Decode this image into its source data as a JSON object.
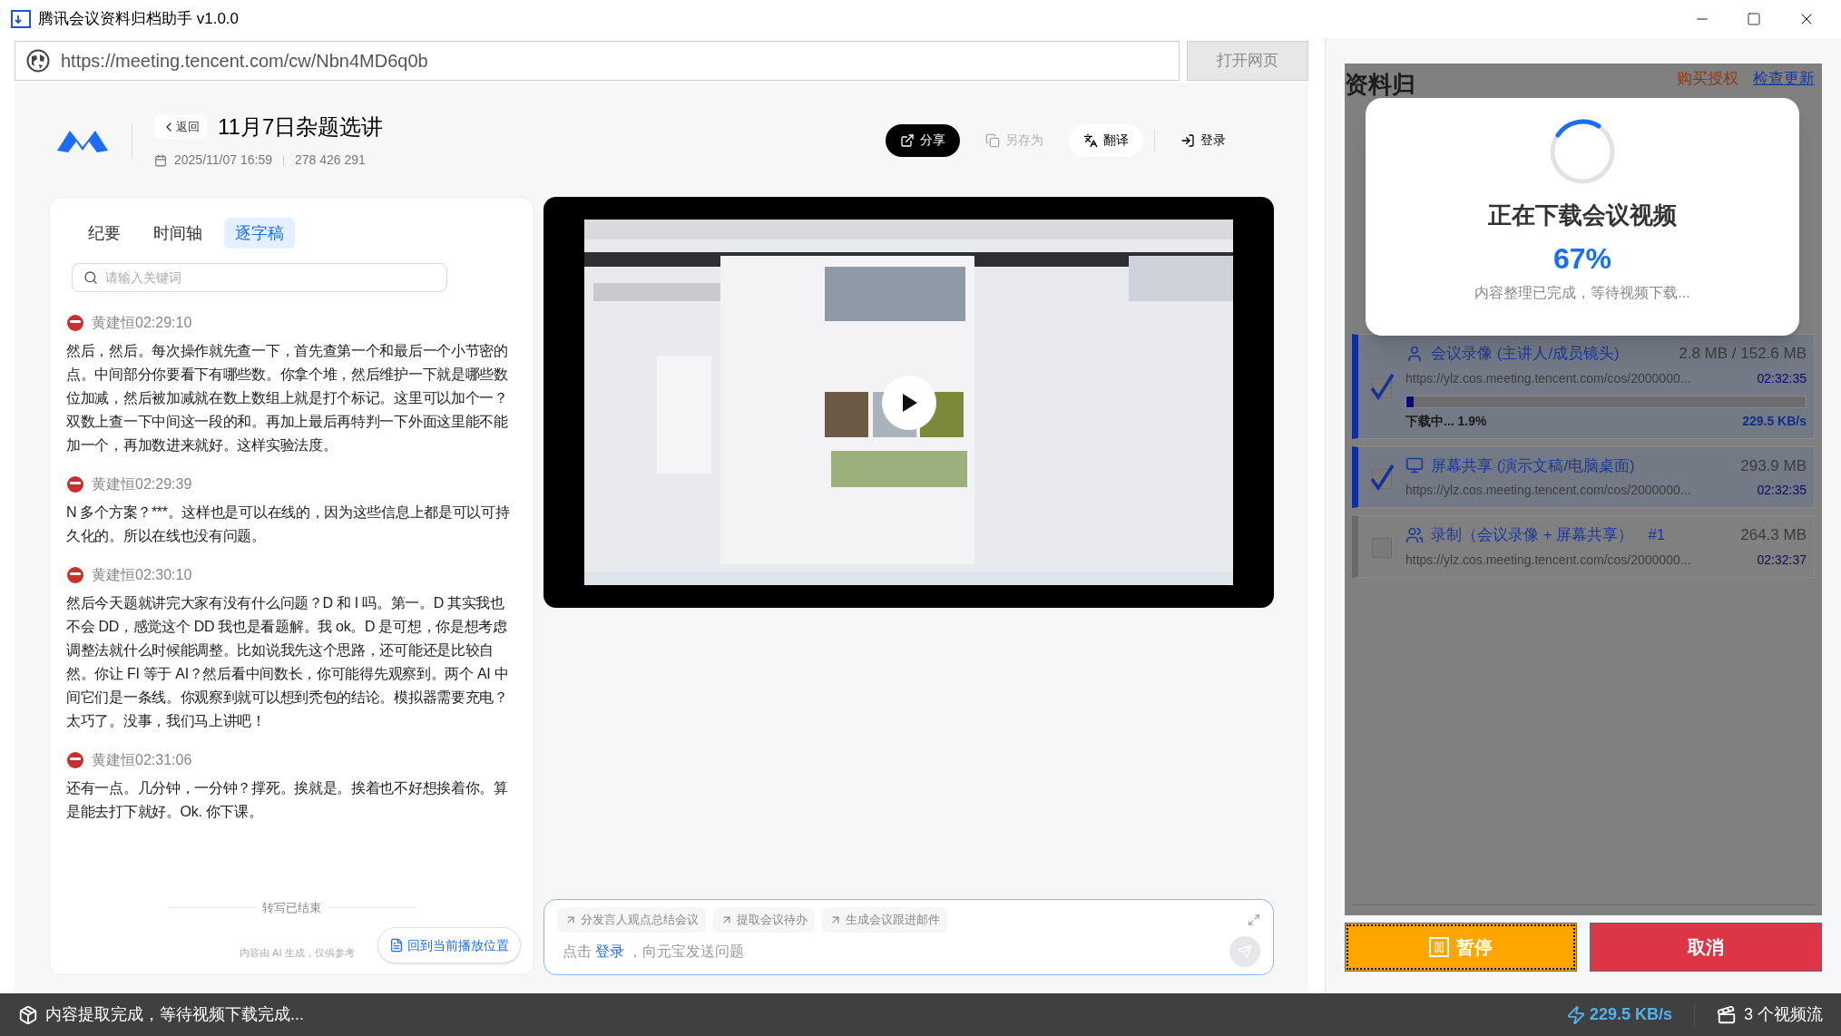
{
  "window": {
    "title": "腾讯会议资料归档助手 v1.0.0"
  },
  "address_bar": {
    "url": "https://meeting.tencent.com/cw/Nbn4MD6q0b",
    "button": "打开网页",
    "button_disabled": true
  },
  "meeting": {
    "back": "返回",
    "title": "11月7日杂题选讲",
    "date": "2025/11/07 16:59",
    "meeting_id": "278 426 291",
    "actions": [
      {
        "label": "分享",
        "kind": "share",
        "disabled": false
      },
      {
        "label": "另存为",
        "kind": "save",
        "disabled": true
      },
      {
        "label": "翻译",
        "kind": "translate",
        "disabled": false
      },
      {
        "label": "登录",
        "kind": "login",
        "disabled": false
      }
    ]
  },
  "transcript": {
    "tabs": [
      {
        "label": "纪要",
        "selected": false
      },
      {
        "label": "时间轴",
        "selected": false
      },
      {
        "label": "逐字稿",
        "selected": true
      }
    ],
    "search": {
      "placeholder": "请输入关键词"
    },
    "entries": [
      {
        "speaker": "黄建恒",
        "time": "02:29:10",
        "text": "然后，然后。每次操作就先查一下，首先查第一个和最后一个小节密的点。中间部分你要看下有哪些数。你拿个堆，然后维护一下就是哪些数位加减，然后被加减就在数上数组上就是打个标记。这里可以加个一？双数上查一下中间这一段的和。再加上最后再特判一下外面这里能不能加一个，再加数进来就好。这样实验法度。"
      },
      {
        "speaker": "黄建恒",
        "time": "02:29:39",
        "text": "N 多个方案？***。这样也是可以在线的，因为这些信息上都是可以可持久化的。所以在线也没有问题。"
      },
      {
        "speaker": "黄建恒",
        "time": "02:30:10",
        "text": "然后今天题就讲完大家有没有什么问题？D 和 I 吗。第一。D 其实我也不会 DD，感觉这个 DD 我也是看题解。我 ok。D 是可想，你是想考虑调整法就什么时候能调整。比如说我先这个思路，还可能还是比较自然。你让 FI 等于 AI？然后看中间数长，你可能得先观察到。两个 AI 中间它们是一条线。你观察到就可以想到秃包的结论。模拟器需要充电？太巧了。没事，我们马上讲吧！"
      },
      {
        "speaker": "黄建恒",
        "time": "02:31:06",
        "text": "还有一点。几分钟，一分钟？撑死。挨就是。挨着也不好想挨着你。算是能去打下就好。Ok. 你下课。"
      }
    ],
    "end_note": "转写已结束",
    "jump_button": "回到当前播放位置",
    "disclaimer": "内容由 AI 生成，仅供参考"
  },
  "chat": {
    "suggestions": [
      "分发言人观点总结会议",
      "提取会议待办",
      "生成会议跟进邮件"
    ],
    "prompt_prefix": "点击",
    "prompt_link": "登录",
    "prompt_suffix": "，向元宝发送问题",
    "send_disabled": true
  },
  "console": {
    "title": "资料归",
    "links": [
      {
        "label": "购买授权",
        "kind": "buy"
      },
      {
        "label": "检查更新",
        "kind": "update"
      }
    ],
    "streams": [
      {
        "kind": "camera",
        "title": "会议录像 (主讲人/成员镜头)",
        "size": "2.8 MB / 152.6 MB",
        "url": "https://ylz.cos.meeting.tencent.com/cos/2000000...",
        "duration": "02:32:35",
        "checked": true,
        "selected": true,
        "progress": {
          "level": 0.019,
          "status": "下载中... 1.9%",
          "speed": "229.5 KB/s"
        }
      },
      {
        "kind": "screen",
        "title": "屏幕共享 (演示文稿/电脑桌面)",
        "size": "293.9 MB",
        "url": "https://ylz.cos.meeting.tencent.com/cos/2000000...",
        "duration": "02:32:35",
        "checked": true,
        "selected": true
      },
      {
        "kind": "recording",
        "title": "录制（会议录像 + 屏幕共享）",
        "tag": "#1",
        "size": "264.3 MB",
        "url": "https://ylz.cos.meeting.tencent.com/cos/2000000...",
        "duration": "02:32:37",
        "checked": false,
        "selected": false
      }
    ],
    "modal": {
      "title": "正在下载会议视频",
      "percent": "67%",
      "message": "内容整理已完成，等待视频下载..."
    },
    "buttons": [
      {
        "label": "暂停",
        "kind": "pause"
      },
      {
        "label": "取消",
        "kind": "cancel"
      }
    ]
  },
  "status_bar": {
    "message": "内容提取完成，等待视频下载完成...",
    "speed": "229.5 KB/s",
    "streams": "3 个视频流"
  }
}
